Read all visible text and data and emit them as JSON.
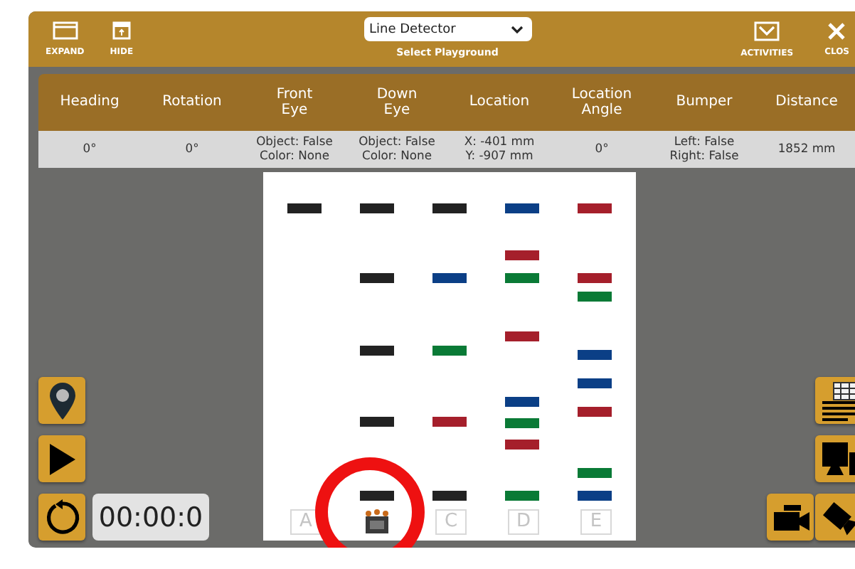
{
  "toolbar": {
    "left": [
      {
        "kind": "expand",
        "label": "EXPAND"
      },
      {
        "kind": "hide",
        "label": "HIDE"
      }
    ],
    "playground": {
      "value": "Line Detector",
      "caption": "Select Playground"
    },
    "right": [
      {
        "kind": "activities",
        "label": "ACTIVITIES"
      },
      {
        "kind": "close",
        "label": "CLOS"
      }
    ]
  },
  "table": {
    "columns": [
      "Heading",
      "Rotation",
      "Front\nEye",
      "Down\nEye",
      "Location",
      "Location\nAngle",
      "Bumper",
      "Distance"
    ],
    "row": [
      "0°",
      "0°",
      "Object: False\nColor: None",
      "Object: False\nColor: None",
      "X: -401 mm\nY: -907 mm",
      "0°",
      "Left: False\nRight: False",
      "1852 mm"
    ]
  },
  "playground": {
    "columns": [
      {
        "kind": "letter",
        "label": "A",
        "lines": [
          {
            "color": "#222222"
          }
        ]
      },
      {
        "kind": "robot",
        "lines": [
          {
            "color": "#222222"
          },
          {
            "color": "#222222"
          },
          {
            "color": "#222222"
          },
          {
            "color": "#222222"
          },
          {
            "color": "#222222"
          }
        ]
      },
      {
        "kind": "letter",
        "label": "C",
        "lines": [
          {
            "color": "#222222"
          },
          {
            "color": "#0b3f86"
          },
          {
            "color": "#0a7a36"
          },
          {
            "color": "#a51f2b"
          },
          {
            "color": "#222222"
          }
        ]
      },
      {
        "kind": "letter",
        "label": "D",
        "lines": [
          {
            "color": "#0b3f86"
          },
          {
            "color": "#a51f2b"
          },
          {
            "color": "#0a7a36"
          },
          {
            "color": "#a51f2b"
          },
          {
            "color": "#0b3f86"
          },
          {
            "color": "#0a7a36"
          },
          {
            "color": "#a51f2b"
          },
          {
            "color": "#0a7a36"
          }
        ]
      },
      {
        "kind": "letter",
        "label": "E",
        "lines": [
          {
            "color": "#a51f2b"
          },
          {
            "color": "#a51f2b"
          },
          {
            "color": "#0a7a36"
          },
          {
            "color": "#0b3f86"
          },
          {
            "color": "#0b3f86"
          },
          {
            "color": "#a51f2b"
          },
          {
            "color": "#0a7a36"
          },
          {
            "color": "#0b3f86"
          }
        ]
      }
    ]
  },
  "controls": {
    "left": [
      {
        "kind": "pin"
      },
      {
        "kind": "play"
      },
      {
        "kind": "reset"
      }
    ],
    "timer": "00:00:0",
    "right": [
      {
        "kind": "grid"
      },
      {
        "kind": "monitor"
      },
      {
        "kind": "camera"
      },
      {
        "kind": "tilt"
      }
    ]
  },
  "annotation": {
    "kind": "circle"
  }
}
